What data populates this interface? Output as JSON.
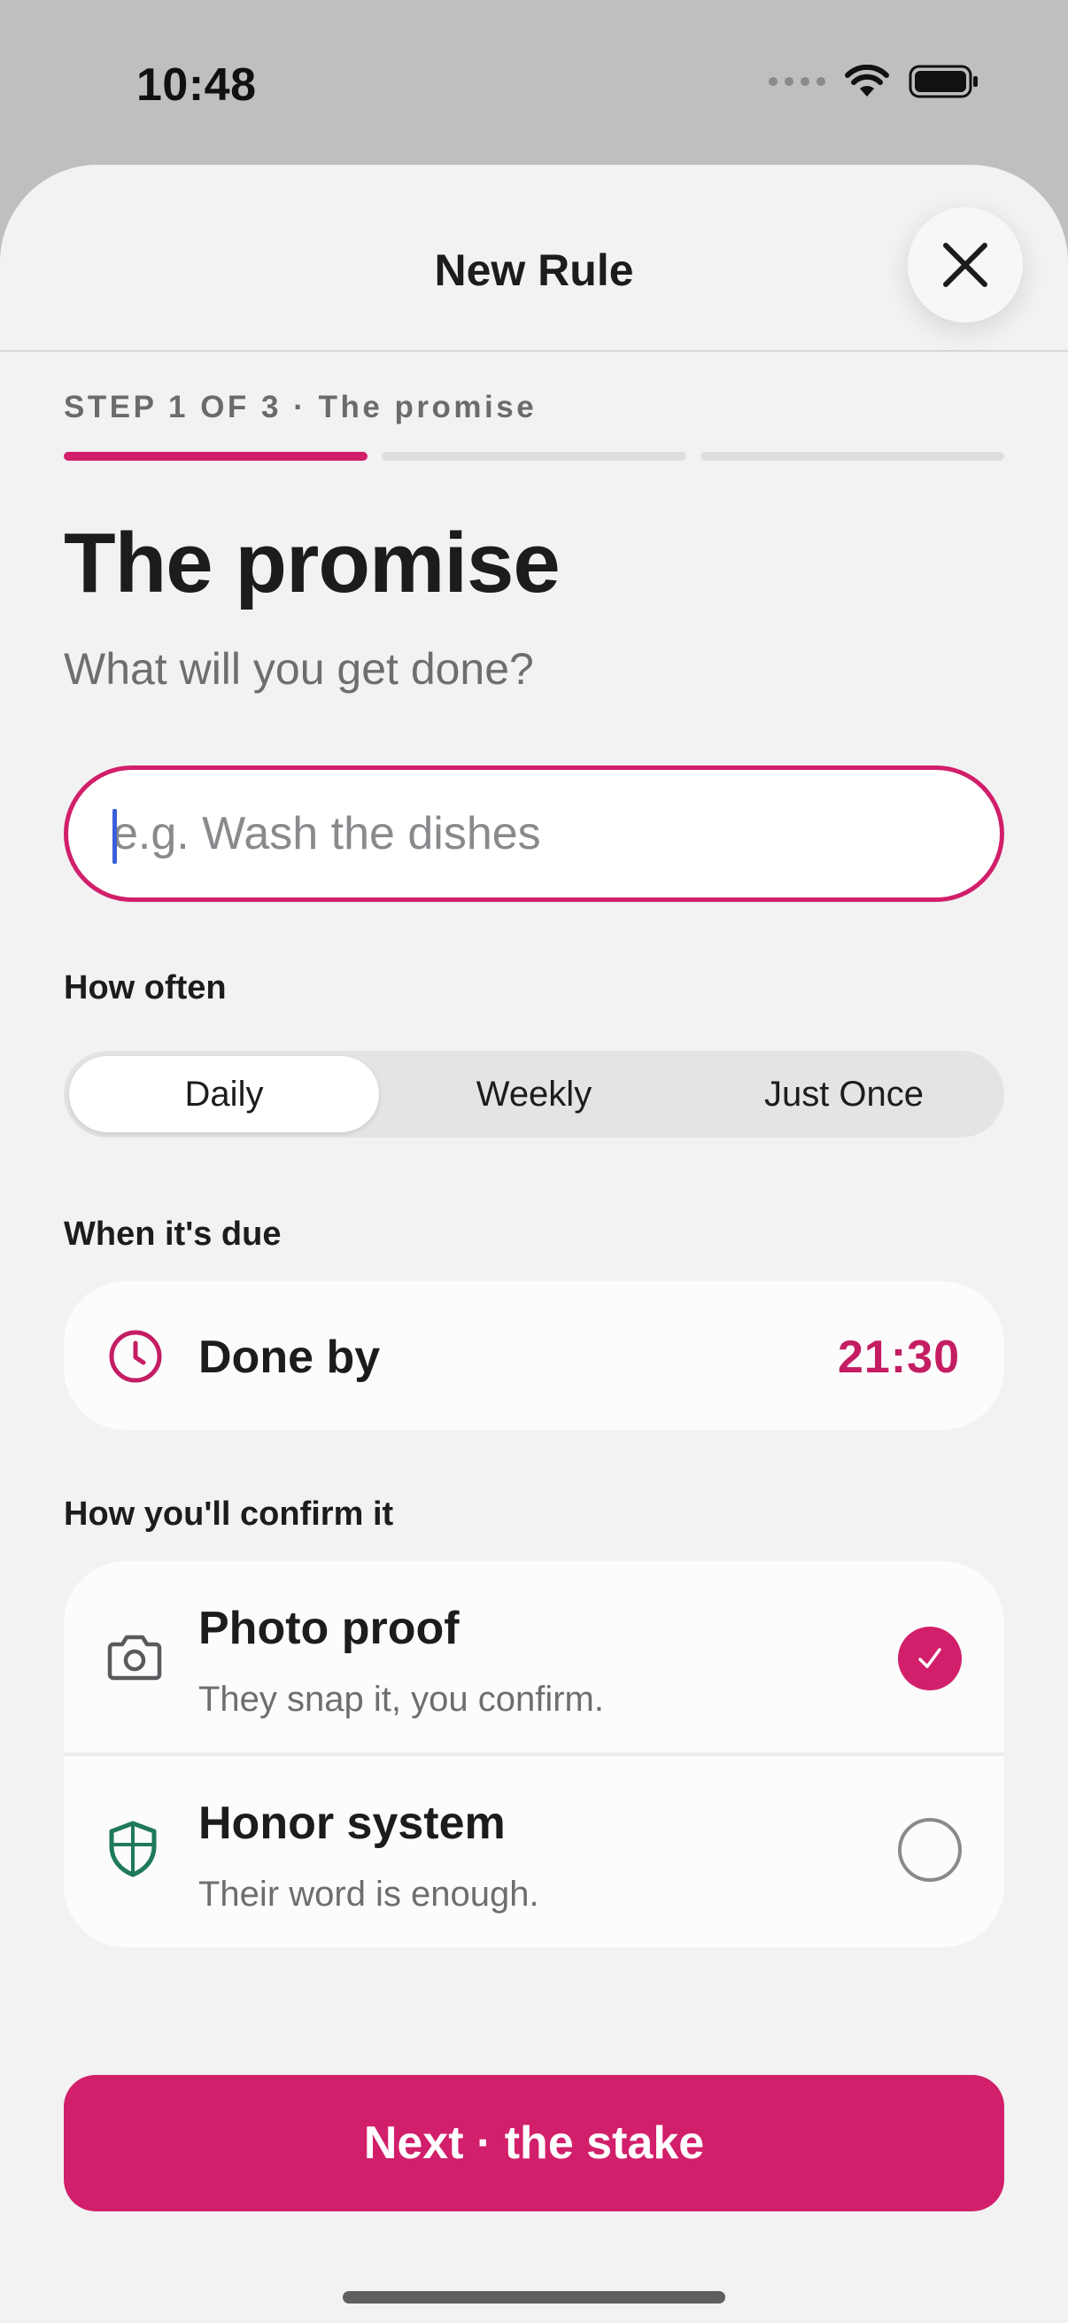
{
  "status_bar": {
    "time": "10:48"
  },
  "header": {
    "title": "New Rule",
    "close_icon": "close-icon"
  },
  "step": {
    "label": "STEP 1 OF 3 · The promise",
    "current": 1,
    "total": 3
  },
  "page": {
    "title": "The promise",
    "subtitle": "What will you get done?"
  },
  "task_input": {
    "value": "",
    "placeholder": "e.g. Wash the dishes"
  },
  "frequency": {
    "label": "How often",
    "options": [
      "Daily",
      "Weekly",
      "Just Once"
    ],
    "selected": "Daily"
  },
  "due": {
    "label": "When it's due",
    "row_label": "Done by",
    "time": "21:30",
    "icon": "clock-icon"
  },
  "confirm": {
    "label": "How you'll confirm it",
    "options": [
      {
        "title": "Photo proof",
        "description": "They snap it, you confirm.",
        "icon": "camera-icon",
        "selected": true
      },
      {
        "title": "Honor system",
        "description": "Their word is enough.",
        "icon": "shield-icon",
        "selected": false
      }
    ]
  },
  "next_button": {
    "label": "Next · the stake"
  },
  "colors": {
    "accent": "#d21f6b",
    "shield": "#1f7a5c",
    "background": "#f2f2f2"
  }
}
